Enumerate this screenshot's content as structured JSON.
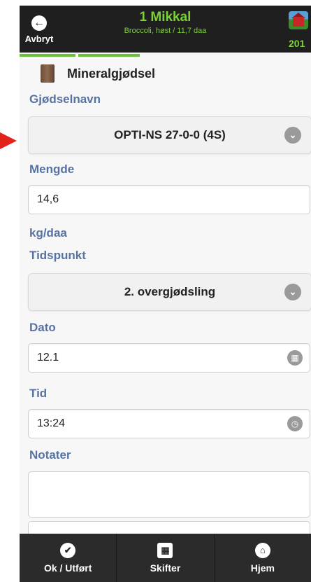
{
  "header": {
    "back_label": "Avbryt",
    "title": "1 Mikkal",
    "subtitle": "Broccoli, høst / 11,7 daa",
    "year_label": "201"
  },
  "section": {
    "title": "Mineralgjødsel"
  },
  "form": {
    "fertilizer_label": "Gjødselnavn",
    "fertilizer_value": "OPTI-NS 27-0-0 (4S)",
    "amount_label": "Mengde",
    "amount_value": "14,6",
    "unit_label": "kg/daa",
    "timing_label": "Tidspunkt",
    "timing_value": "2. overgjødsling",
    "date_label": "Dato",
    "date_value": "12.1",
    "time_label": "Tid",
    "time_value": "13:24",
    "notes_label": "Notater",
    "notes_value": ""
  },
  "footer": {
    "ok_label": "Ok / Utført",
    "fields_label": "Skifter",
    "home_label": "Hjem"
  },
  "icons": {
    "back": "arrow-left-icon",
    "year": "farm-barn-icon",
    "chevron": "chevron-down-icon",
    "calendar": "calendar-icon",
    "clock": "clock-icon",
    "ok": "check-icon",
    "fields": "grid-icon",
    "home": "home-icon"
  },
  "colors": {
    "accent_green": "#7cd03b",
    "label_blue": "#5873a3",
    "topbar": "#1f1f1f",
    "bottombar": "#2b2b2b",
    "pointer_red": "#e2231a"
  }
}
